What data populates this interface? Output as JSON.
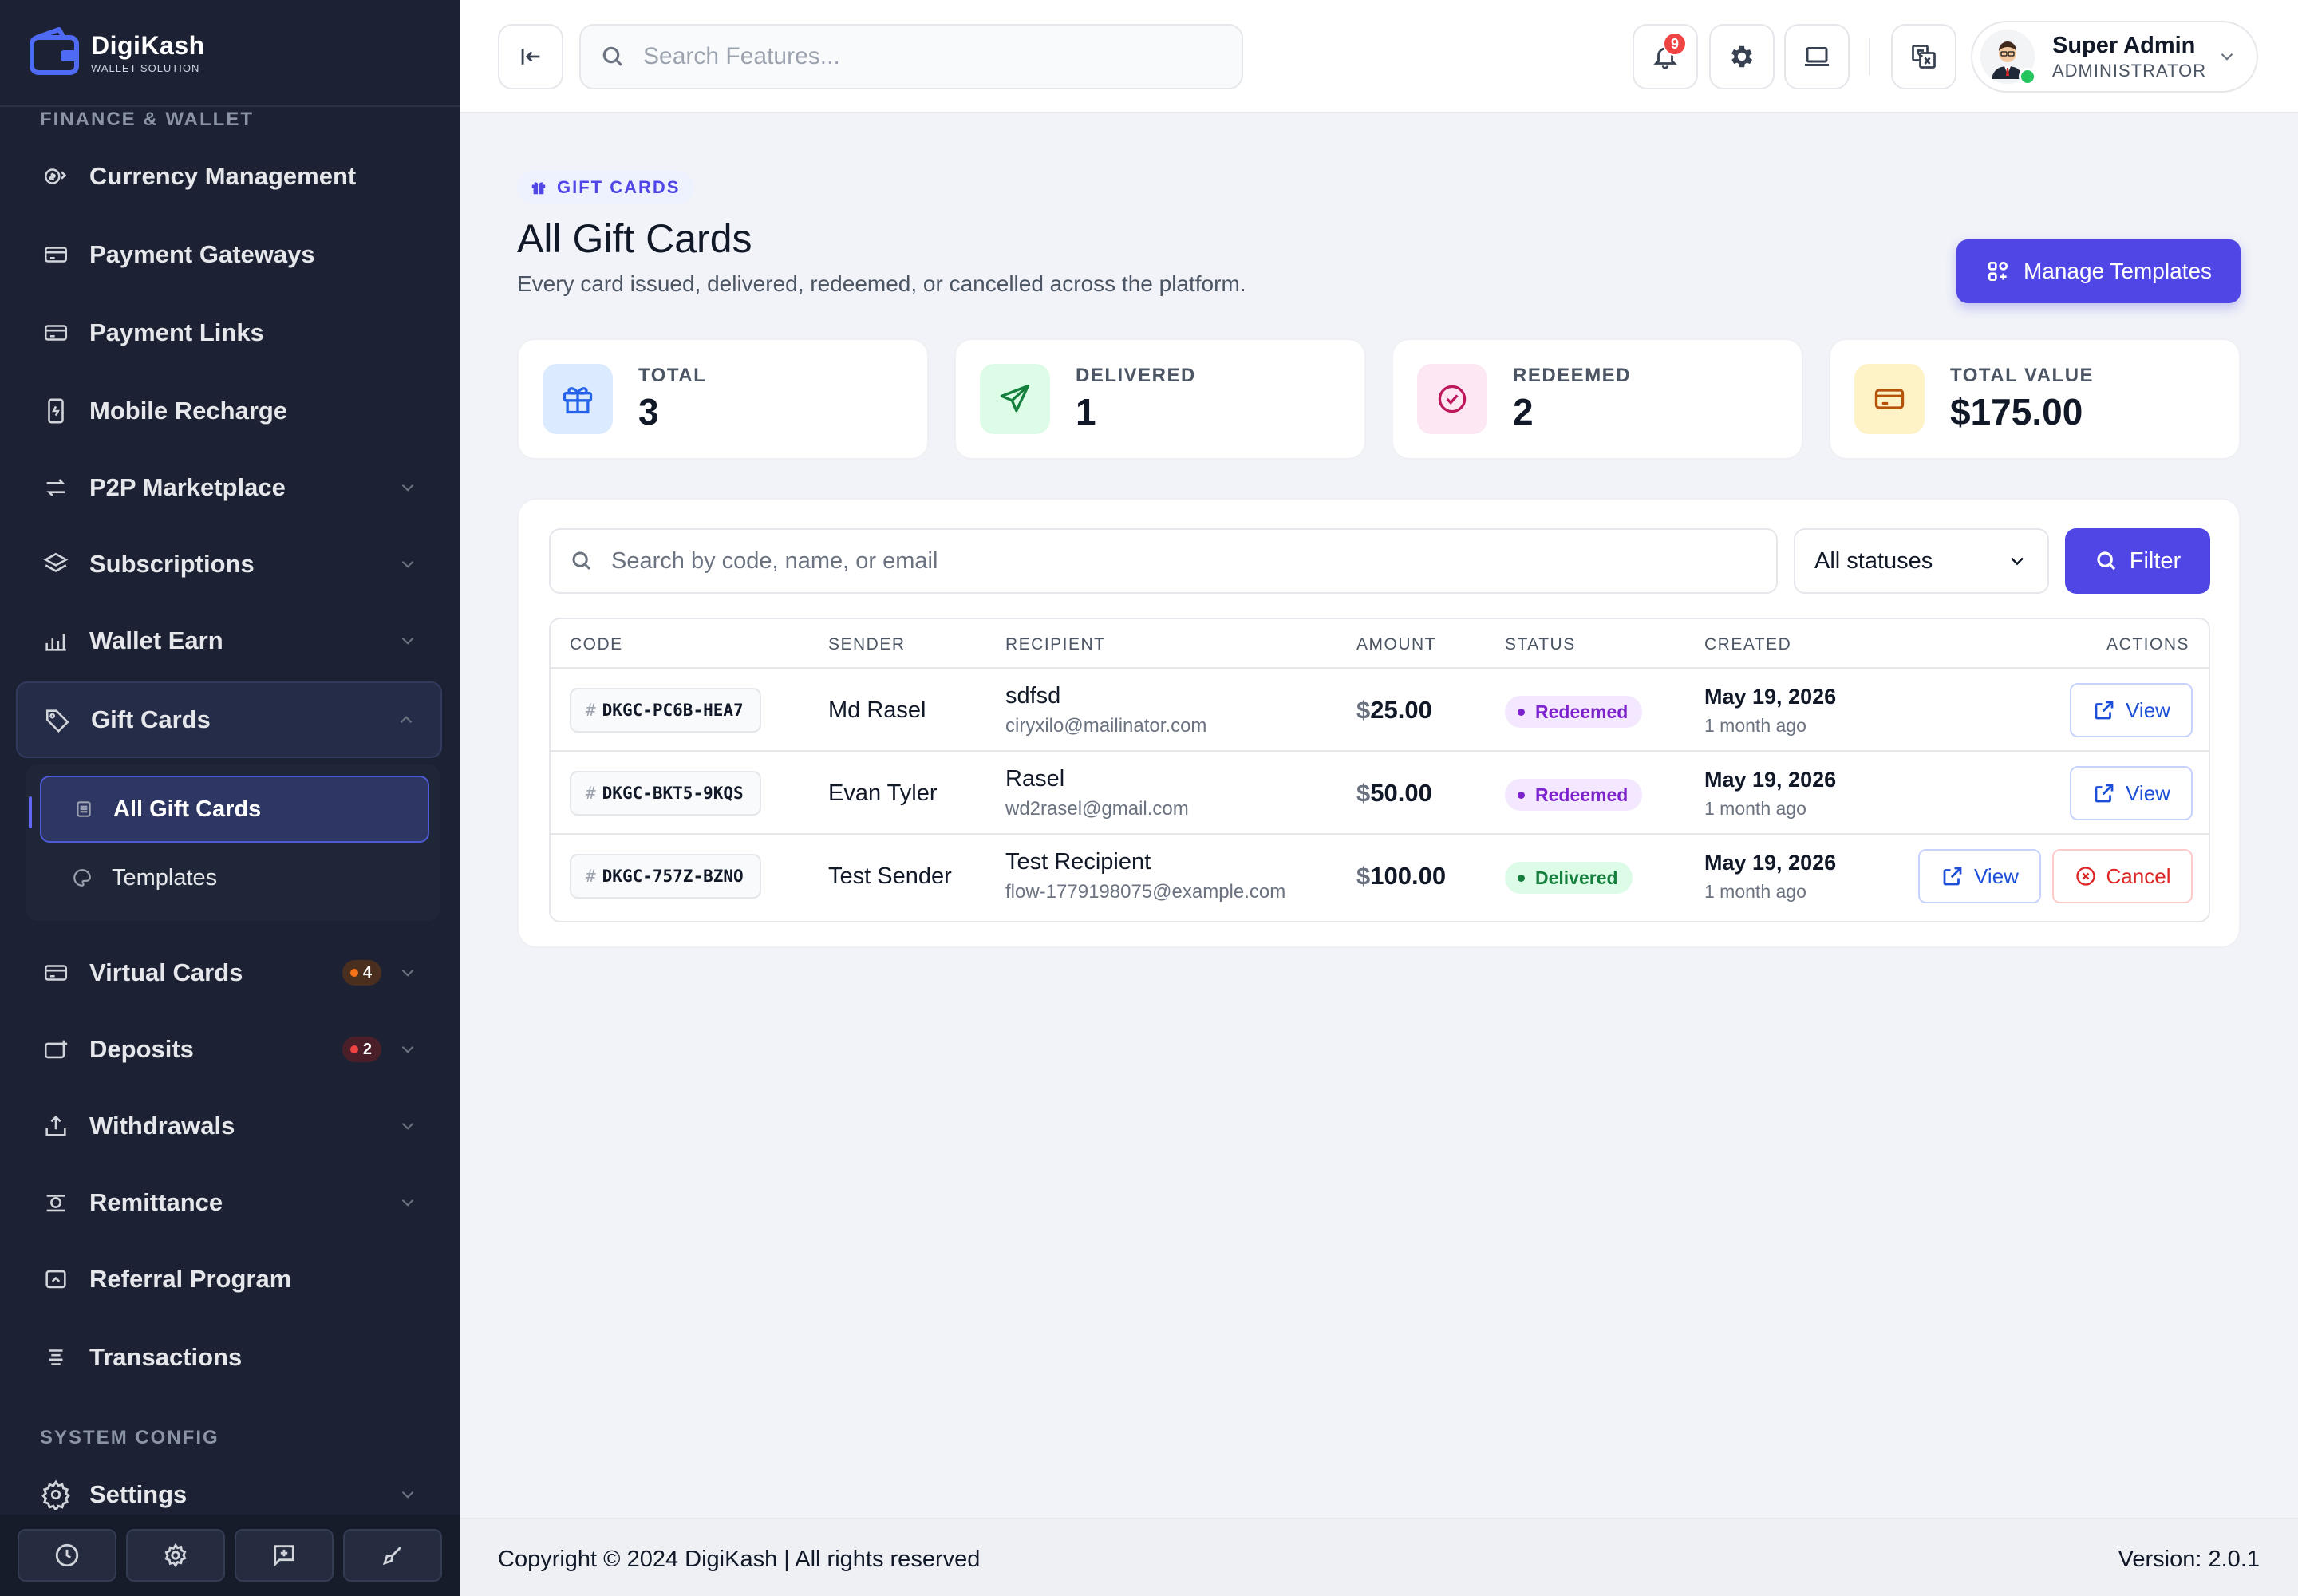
{
  "brand": {
    "name": "DigiKash",
    "tagline": "WALLET SOLUTION"
  },
  "sidebar": {
    "section_finance": "FINANCE & WALLET",
    "section_system": "SYSTEM CONFIG",
    "items": [
      {
        "label": "Currency Management",
        "icon": "currency-icon",
        "has_chevron": false
      },
      {
        "label": "Payment Gateways",
        "icon": "card-icon",
        "has_chevron": false
      },
      {
        "label": "Payment Links",
        "icon": "card-icon",
        "has_chevron": false
      },
      {
        "label": "Mobile Recharge",
        "icon": "mobile-icon",
        "has_chevron": false
      },
      {
        "label": "P2P Marketplace",
        "icon": "exchange-icon",
        "has_chevron": true
      },
      {
        "label": "Subscriptions",
        "icon": "layers-icon",
        "has_chevron": true
      },
      {
        "label": "Wallet Earn",
        "icon": "chart-icon",
        "has_chevron": true
      },
      {
        "label": "Gift Cards",
        "icon": "tag-icon",
        "has_chevron": true,
        "open": true
      },
      {
        "label": "Virtual Cards",
        "icon": "card-icon",
        "has_chevron": true,
        "badge": "4"
      },
      {
        "label": "Deposits",
        "icon": "wallet-plus-icon",
        "has_chevron": true,
        "badge": "2"
      },
      {
        "label": "Withdrawals",
        "icon": "upload-icon",
        "has_chevron": true
      },
      {
        "label": "Remittance",
        "icon": "remit-icon",
        "has_chevron": true
      },
      {
        "label": "Referral Program",
        "icon": "referral-icon",
        "has_chevron": false
      },
      {
        "label": "Transactions",
        "icon": "list-icon",
        "has_chevron": false
      },
      {
        "label": "Settings",
        "icon": "gear-icon",
        "has_chevron": true
      }
    ],
    "gift_sub": [
      {
        "label": "All Gift Cards",
        "active": true
      },
      {
        "label": "Templates",
        "active": false
      }
    ]
  },
  "topbar": {
    "search_placeholder": "Search Features...",
    "notification_count": "9",
    "user_name": "Super Admin",
    "user_role": "ADMINISTRATOR"
  },
  "page": {
    "eyebrow": "GIFT CARDS",
    "title": "All Gift Cards",
    "subtitle": "Every card issued, delivered, redeemed, or cancelled across the platform.",
    "manage_button": "Manage Templates"
  },
  "stats": [
    {
      "label": "TOTAL",
      "value": "3"
    },
    {
      "label": "DELIVERED",
      "value": "1"
    },
    {
      "label": "REDEEMED",
      "value": "2"
    },
    {
      "label": "TOTAL VALUE",
      "value": "$175.00"
    }
  ],
  "filters": {
    "search_placeholder": "Search by code, name, or email",
    "status_selected": "All statuses",
    "filter_button": "Filter"
  },
  "table": {
    "headers": [
      "CODE",
      "SENDER",
      "RECIPIENT",
      "AMOUNT",
      "STATUS",
      "CREATED",
      "ACTIONS"
    ],
    "rows": [
      {
        "code": "DKGC-PC6B-HEA7",
        "sender": "Md Rasel",
        "recipient_name": "sdfsd",
        "recipient_email": "ciryxilo@mailinator.com",
        "currency": "$",
        "amount": "25.00",
        "status": "Redeemed",
        "created": "May 19, 2026",
        "ago": "1 month ago",
        "view": "View"
      },
      {
        "code": "DKGC-BKT5-9KQS",
        "sender": "Evan Tyler",
        "recipient_name": "Rasel",
        "recipient_email": "wd2rasel@gmail.com",
        "currency": "$",
        "amount": "50.00",
        "status": "Redeemed",
        "created": "May 19, 2026",
        "ago": "1 month ago",
        "view": "View"
      },
      {
        "code": "DKGC-757Z-BZNO",
        "sender": "Test Sender",
        "recipient_name": "Test Recipient",
        "recipient_email": "flow-1779198075@example.com",
        "currency": "$",
        "amount": "100.00",
        "status": "Delivered",
        "created": "May 19, 2026",
        "ago": "1 month ago",
        "view": "View",
        "cancel": "Cancel"
      }
    ]
  },
  "footer": {
    "copyright": "Copyright © 2024 DigiKash | All rights reserved",
    "version": "Version: 2.0.1"
  },
  "colors": {
    "sidebar_bg": "#1c2233",
    "accent": "#4f46e5",
    "redeemed": "#7e22ce",
    "delivered": "#15803d",
    "danger": "#dc2626"
  }
}
